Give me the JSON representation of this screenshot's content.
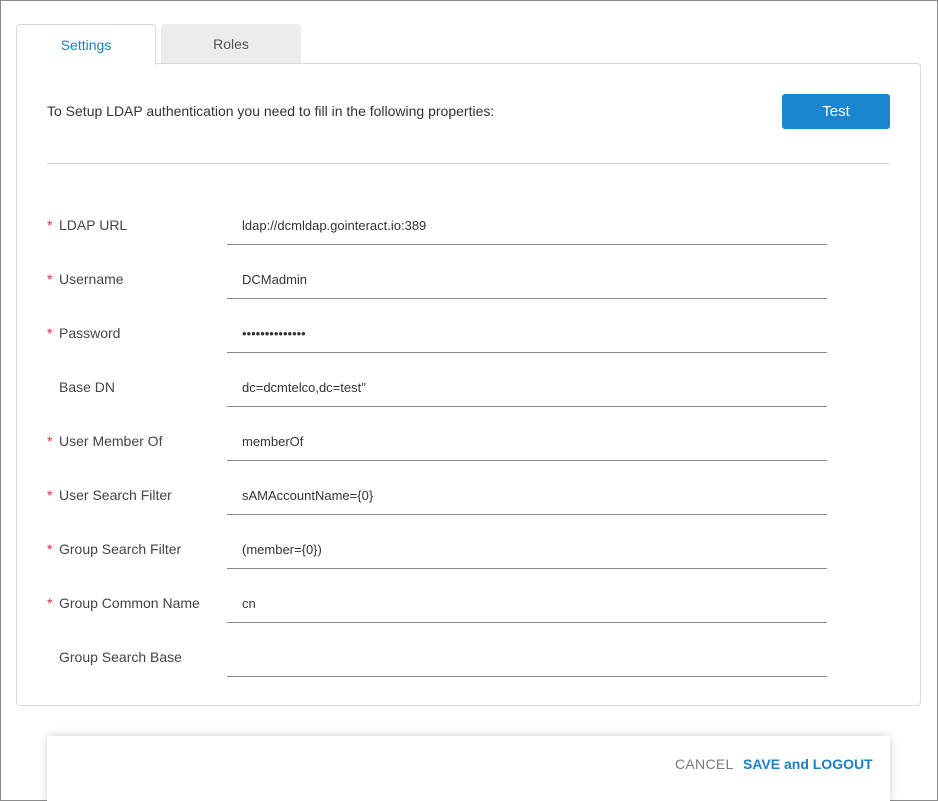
{
  "tabs": [
    {
      "label": "Settings",
      "active": true
    },
    {
      "label": "Roles",
      "active": false
    }
  ],
  "intro_text": "To Setup LDAP authentication you need to fill in the following properties:",
  "test_button": "Test",
  "fields": [
    {
      "label": "LDAP URL",
      "required": "*",
      "value": "ldap://dcmldap.gointeract.io:389"
    },
    {
      "label": "Username",
      "required": "*",
      "value": "DCMadmin"
    },
    {
      "label": "Password",
      "required": "*",
      "value": "••••••••••••••"
    },
    {
      "label": "Base DN",
      "required": "",
      "value": "dc=dcmtelco,dc=test\""
    },
    {
      "label": "User Member Of",
      "required": "*",
      "value": "memberOf"
    },
    {
      "label": "User Search Filter",
      "required": "*",
      "value": "sAMAccountName={0}"
    },
    {
      "label": "Group Search Filter",
      "required": "*",
      "value": "(member={0})"
    },
    {
      "label": "Group Common Name",
      "required": "*",
      "value": "cn"
    },
    {
      "label": "Group Search Base",
      "required": "",
      "value": ""
    }
  ],
  "footer": {
    "cancel_label": "CANCEL",
    "save_label": "SAVE and LOGOUT"
  },
  "colors": {
    "accent": "#1a86d0",
    "required": "#d9363e"
  }
}
